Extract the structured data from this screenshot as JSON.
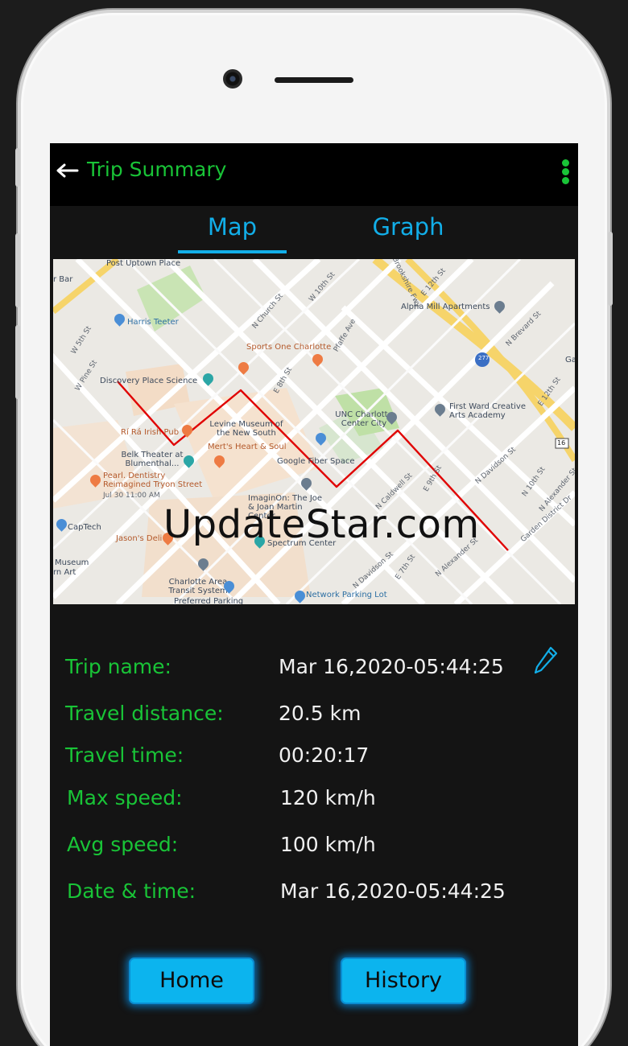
{
  "app_bar": {
    "back_icon": "arrow-left-icon",
    "title": "Trip Summary",
    "menu_icon": "more-vertical-icon",
    "accent_color": "#19c437"
  },
  "tabs": [
    {
      "label": "Map",
      "selected": true
    },
    {
      "label": "Graph",
      "selected": false
    }
  ],
  "tab_color": "#12aee8",
  "map": {
    "route_color": "#e00000",
    "places": [
      "Post Uptown Place",
      "Harris Teeter",
      "Discovery Place Science",
      "Sports One Charlotte",
      "Alpha Mill Apartments",
      "UNC Charlotte Center City",
      "First Ward Creative Arts Academy",
      "Levine Museum of the New South",
      "Mert's Heart & Soul",
      "Rí Rá Irish Pub",
      "Belk Theater at Blumenthal...",
      "Pearl. Dentistry Reimagined Tryon Street",
      "Jul 30 11:00 AM",
      "Google Fiber Space",
      "ImaginOn: The Joe & Joan Martin Center",
      "Spectrum Center",
      "CapTech",
      "Jason's Deli",
      "Museum",
      "rn Art",
      "Charlotte Area Transit System",
      "Preferred Parking",
      "Network Parking Lot",
      "Gard",
      "r Bar"
    ],
    "streets": [
      "W 5th St",
      "W Pine St",
      "N Church St",
      "W 10th St",
      "Pfaffe Ave",
      "E 12th St",
      "N Brevard St",
      "E 12th St",
      "E 8th St",
      "E 9th St",
      "N Caldwell St",
      "N Davidson St",
      "N 10th St",
      "N Alexander St",
      "Garden District Dr",
      "E 7th St",
      "N Davidson St",
      "N Alexander St",
      "Brookshire Fwy",
      "E 9th St"
    ],
    "highway_shield": "277",
    "route_shield": "16"
  },
  "watermark": "UpdateStar.com",
  "details": {
    "trip_name_label": "Trip name:",
    "trip_name_value": "Mar 16,2020-05:44:25",
    "distance_label": "Travel distance:",
    "distance_value": "20.5 km",
    "time_label": "Travel time:",
    "time_value": "00:20:17",
    "max_speed_label": "Max speed:",
    "max_speed_value": "120 km/h",
    "avg_speed_label": "Avg speed:",
    "avg_speed_value": "100 km/h",
    "datetime_label": "Date & time:",
    "datetime_value": "Mar 16,2020-05:44:25",
    "edit_icon": "pencil-icon"
  },
  "buttons": {
    "home_label": "Home",
    "history_label": "History",
    "color": "#0cb4ee"
  }
}
